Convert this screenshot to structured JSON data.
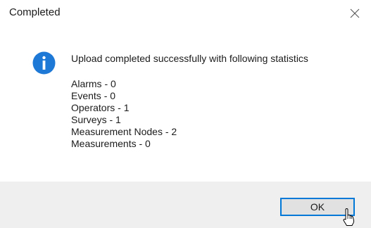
{
  "window": {
    "title": "Completed",
    "close_icon": "close-icon"
  },
  "dialog": {
    "icon": "info-icon",
    "icon_color": "#1e78d6",
    "message": "Upload completed successfully with following statistics",
    "stats": [
      "Alarms - 0",
      "Events - 0",
      "Operators - 1",
      "Surveys - 1",
      "Measurement Nodes - 2",
      "Measurements - 0"
    ]
  },
  "footer": {
    "ok_label": "OK",
    "accent": "#0078d7"
  },
  "cursor": {
    "icon": "pointer-hand-icon"
  }
}
